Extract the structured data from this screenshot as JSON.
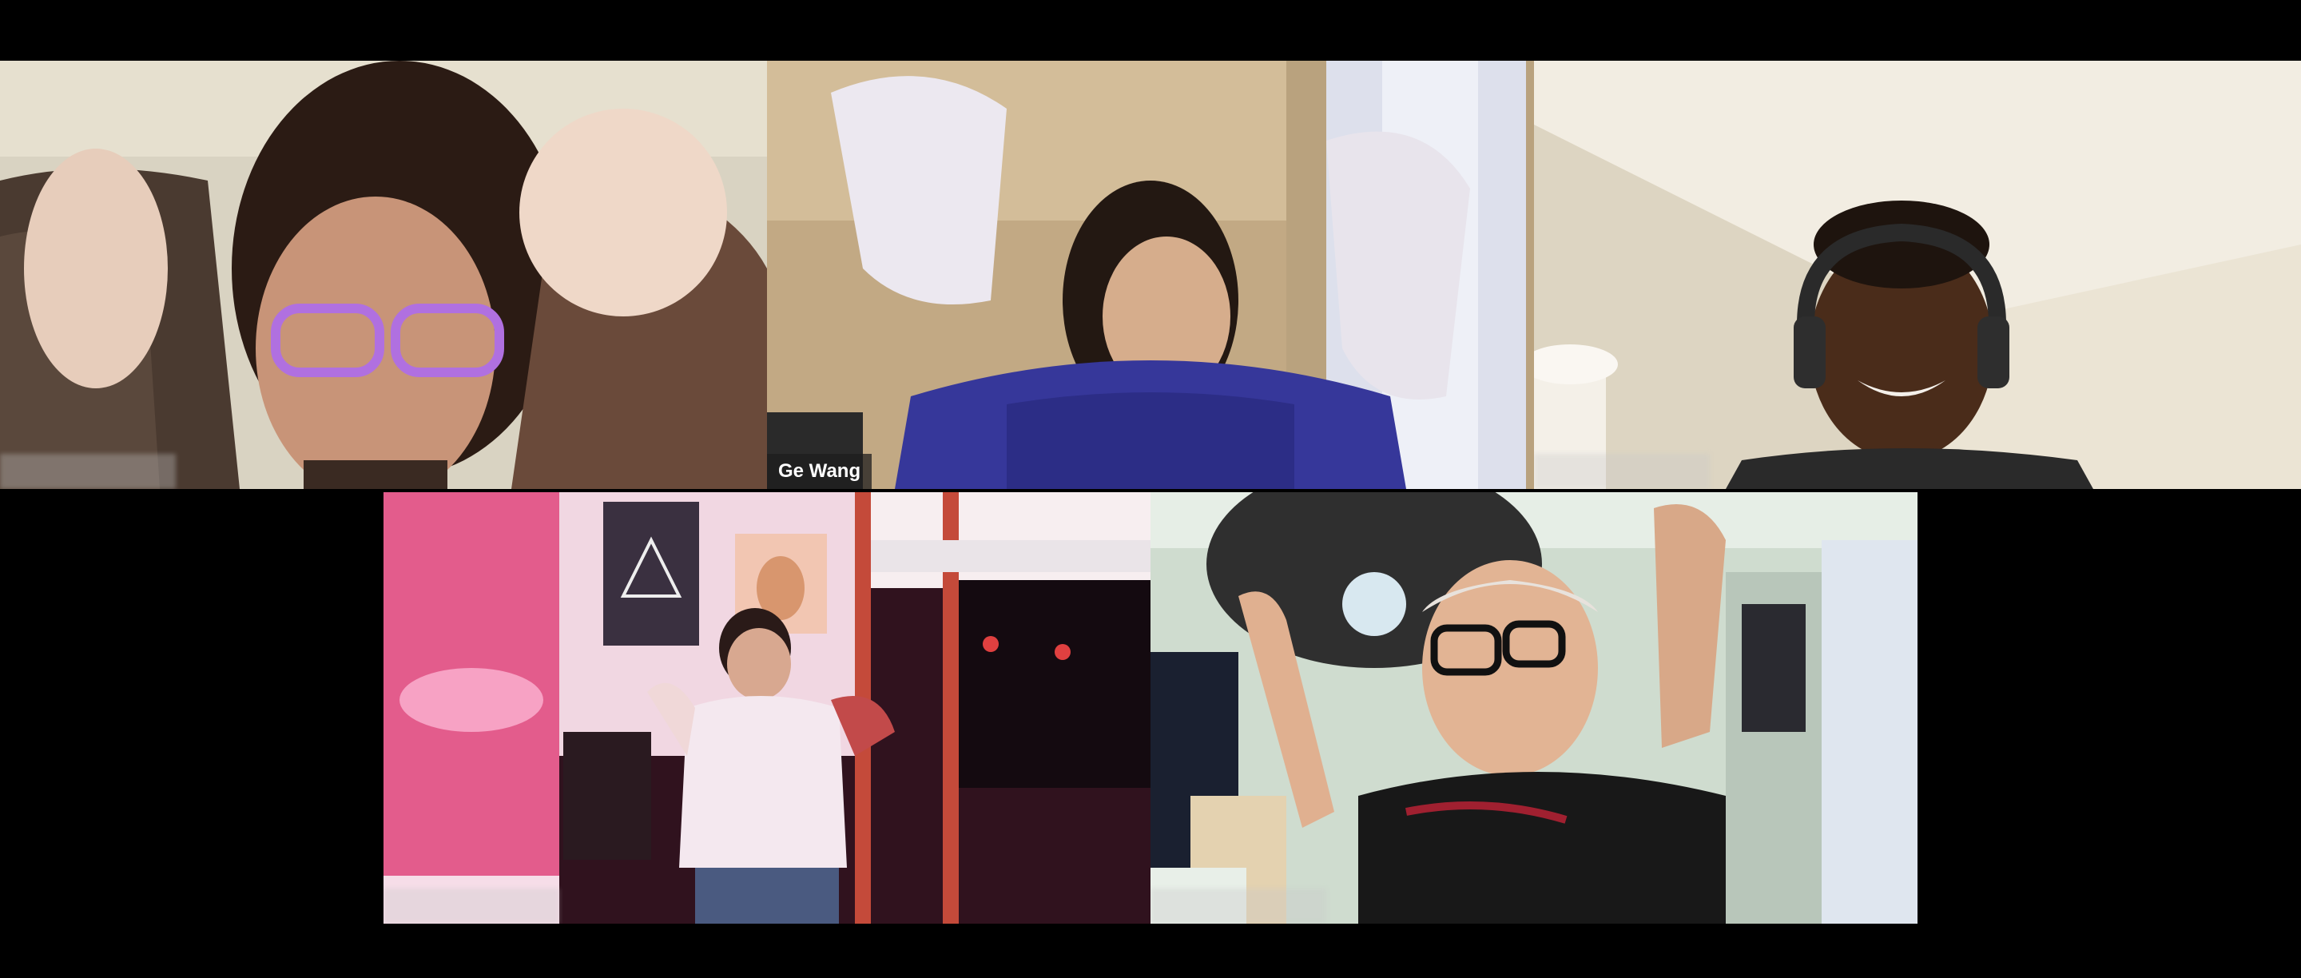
{
  "meeting": {
    "layout": "gallery-view",
    "participant_count": 5
  },
  "participants": [
    {
      "name": "",
      "tile_colors": {
        "wall": "#d8d2c0",
        "couch": "#4a3a32",
        "skin": "#c8967a",
        "hair": "#2a1a14",
        "glasses": "#b070e0"
      }
    },
    {
      "name": "Ge Wang",
      "tile_colors": {
        "wall": "#c9b18a",
        "shirt": "#3a3a9a",
        "skin": "#d8b090",
        "hair": "#231814",
        "curtain": "#dde0ee"
      }
    },
    {
      "name": "",
      "tile_colors": {
        "wall": "#ece6d8",
        "ceiling": "#f2eee4",
        "skin": "#5a3420",
        "headphones": "#333"
      }
    },
    {
      "name": "",
      "tile_colors": {
        "wall": "#e25a8a",
        "shirt": "#f4e8ef",
        "bed": "#c84a3a",
        "dark": "#200a12"
      }
    },
    {
      "name": "",
      "tile_colors": {
        "wall": "#cfe0d0",
        "shirt": "#1a1a1a",
        "skin": "#e0b090",
        "ceiling": "#3a3a3a"
      }
    }
  ]
}
